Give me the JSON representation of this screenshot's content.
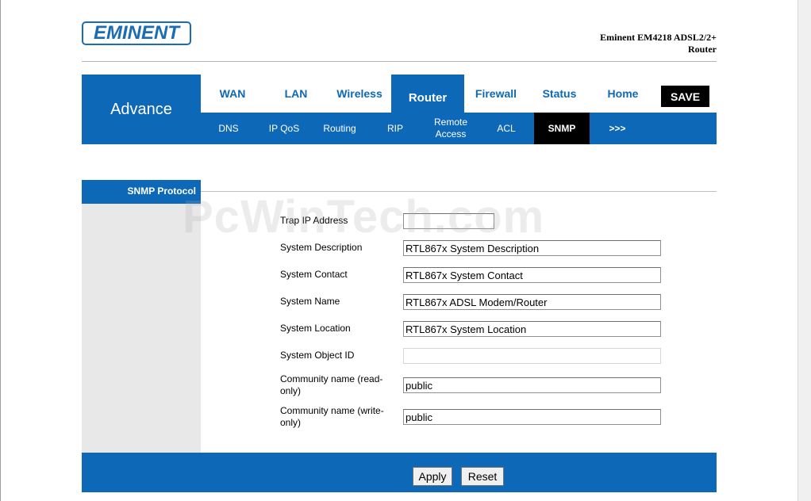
{
  "brand": {
    "logo_text": "EMINENT",
    "model_line1": "Eminent EM4218 ADSL2/2+",
    "model_line2": "Router"
  },
  "nav": {
    "section_title": "Advance",
    "tabs": [
      "WAN",
      "LAN",
      "Wireless",
      "Router",
      "Firewall",
      "Status",
      "Home"
    ],
    "active_tab": "Router",
    "save_label": "SAVE"
  },
  "subnav": {
    "items": [
      "DNS",
      "IP QoS",
      "Routing",
      "RIP",
      "Remote Access",
      "ACL",
      "SNMP",
      ">>>"
    ],
    "active": "SNMP"
  },
  "sidebar": {
    "heading": "SNMP Protocol"
  },
  "watermark": "PcWinTech.com",
  "form": {
    "trap_ip": {
      "label": "Trap IP Address",
      "value": ""
    },
    "sys_desc": {
      "label": "System Description",
      "value": "RTL867x System Description"
    },
    "sys_contact": {
      "label": "System Contact",
      "value": "RTL867x System Contact"
    },
    "sys_name": {
      "label": "System Name",
      "value": "RTL867x ADSL Modem/Router"
    },
    "sys_location": {
      "label": "System Location",
      "value": "RTL867x System Location"
    },
    "sys_object_id": {
      "label": "System Object ID",
      "value": ""
    },
    "community_ro": {
      "label": "Community name (read-only)",
      "value": "public"
    },
    "community_rw": {
      "label": "Community name (write-only)",
      "value": "public"
    }
  },
  "actions": {
    "apply_label": "Apply",
    "reset_label": "Reset"
  },
  "colors": {
    "brand_blue": "#0e68b8",
    "active_subtab": "#000000",
    "sidebar_gray": "#e8e8e8"
  }
}
